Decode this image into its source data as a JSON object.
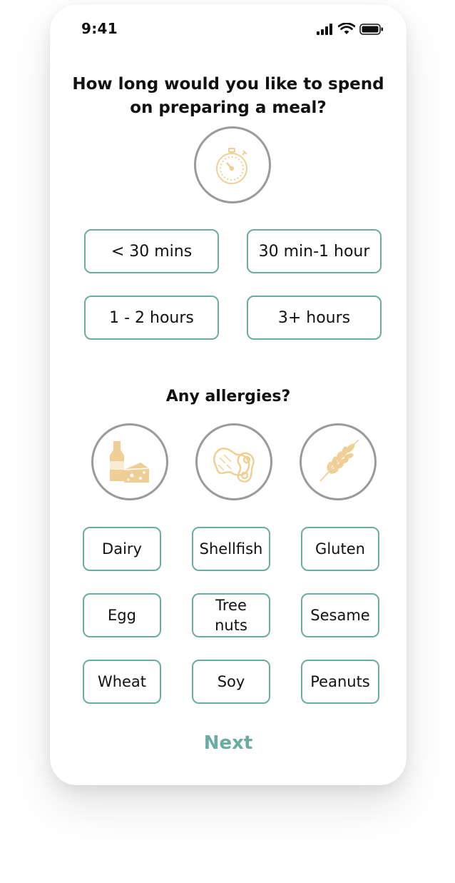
{
  "status_bar": {
    "time": "9:41"
  },
  "question": {
    "title": "How long would you like to spend on preparing a meal?"
  },
  "time_options": [
    "< 30 mins",
    "30 min-1 hour",
    "1 - 2 hours",
    "3+ hours"
  ],
  "allergies": {
    "title": "Any allergies?",
    "icons": [
      "dairy-icon",
      "peanut-icon",
      "wheat-icon"
    ],
    "options": [
      "Dairy",
      "Shellfish",
      "Gluten",
      "Egg",
      "Tree nuts",
      "Sesame",
      "Wheat",
      "Soy",
      "Peanuts"
    ]
  },
  "actions": {
    "next_label": "Next"
  },
  "colors": {
    "accent": "#6aaba2",
    "icon_tint": "#f0cf96",
    "circle_border": "#9a9a9a"
  }
}
